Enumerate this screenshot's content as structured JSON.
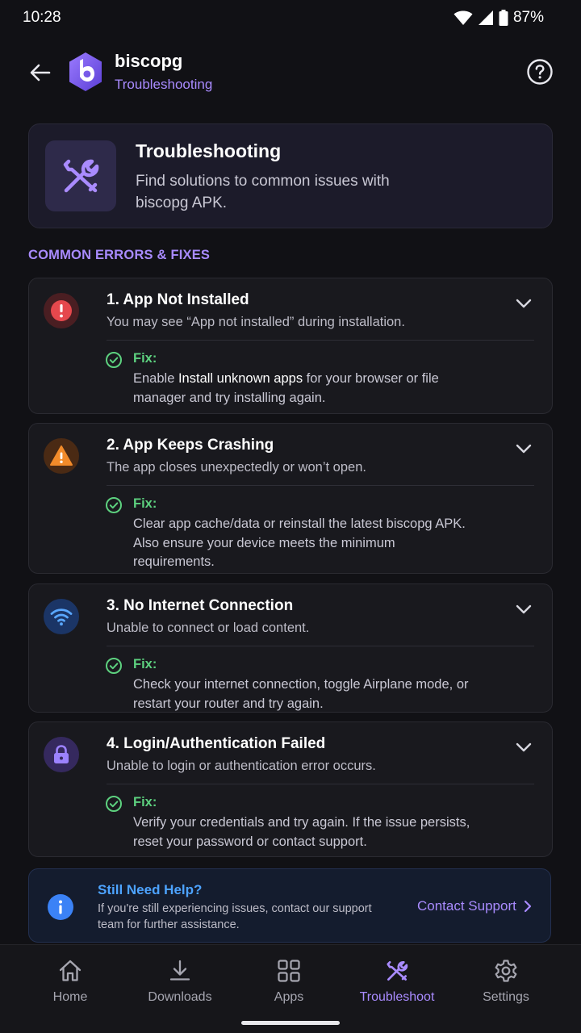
{
  "status_bar": {
    "time": "10:28",
    "battery": "87%"
  },
  "app_bar": {
    "app_name": "biscopg",
    "subtitle": "Troubleshooting"
  },
  "hero": {
    "title": "Troubleshooting",
    "description": "Find solutions to common issues with biscopg APK."
  },
  "section_label": "COMMON ERRORS & FIXES",
  "issues": [
    {
      "title": "1. App Not Installed",
      "description": "You may see “App not installed” during installation.",
      "fix_label": "Fix:",
      "fix_pre": "Enable ",
      "fix_strong": "Install unknown apps",
      "fix_post": " for your browser or file manager and try installing again.",
      "icon": "error-icon",
      "color": "#E5484D"
    },
    {
      "title": "2. App Keeps Crashing",
      "description": "The app closes unexpectedly or won’t open.",
      "fix_label": "Fix:",
      "fix_text": "Clear app cache/data or reinstall the latest biscopg APK. Also ensure your device meets the minimum requirements.",
      "icon": "warning-icon",
      "color": "#F28B2A"
    },
    {
      "title": "3. No Internet Connection",
      "description": "Unable to connect or load content.",
      "fix_label": "Fix:",
      "fix_text": "Check your internet connection, toggle Airplane mode, or restart your router and try again.",
      "icon": "wifi-icon",
      "color": "#3B82F6"
    },
    {
      "title": "4. Login/Authentication Failed",
      "description": "Unable to login or authentication error occurs.",
      "fix_label": "Fix:",
      "fix_text": "Verify your credentials and try again. If the issue persists, reset your password or contact support.",
      "icon": "lock-icon",
      "color": "#8B6CFF"
    }
  ],
  "help": {
    "title": "Still Need Help?",
    "description": "If you're still experiencing issues, contact our support team for further assistance.",
    "link": "Contact Support"
  },
  "nav": [
    {
      "label": "Home",
      "icon": "home-icon"
    },
    {
      "label": "Downloads",
      "icon": "download-icon"
    },
    {
      "label": "Apps",
      "icon": "apps-grid-icon"
    },
    {
      "label": "Troubleshoot",
      "icon": "tools-icon",
      "active": true
    },
    {
      "label": "Settings",
      "icon": "gear-icon"
    }
  ],
  "colors": {
    "accent": "#A98BFF",
    "success": "#5DD17F",
    "info": "#4DA3FF",
    "background": "#111115"
  }
}
